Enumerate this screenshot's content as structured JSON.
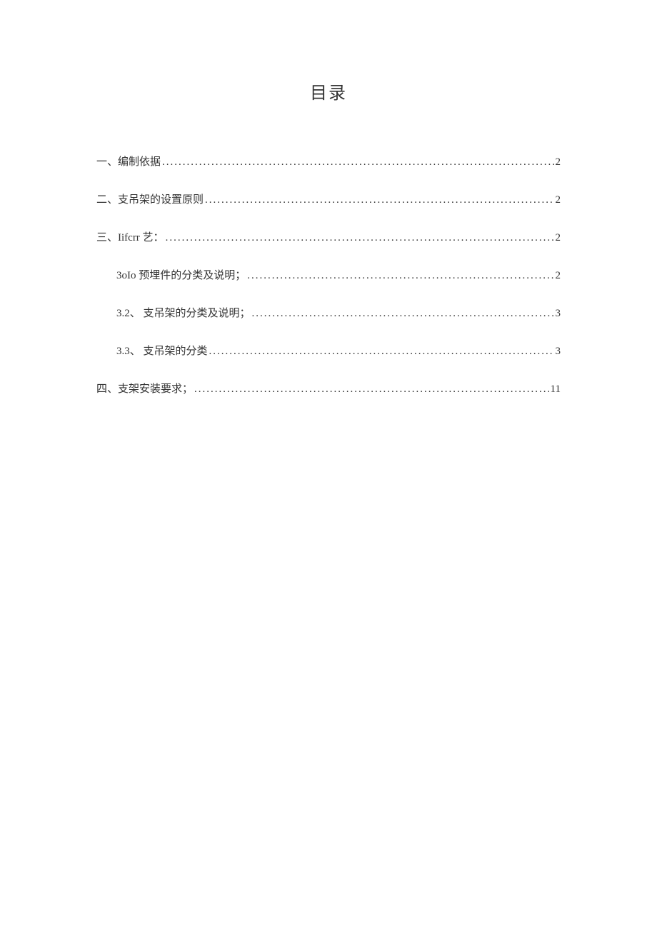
{
  "title": "目录",
  "entries": [
    {
      "label": "一、编制依据",
      "page": "2",
      "indent": false
    },
    {
      "label": "二、支吊架的设置原则",
      "page": "2",
      "indent": false
    },
    {
      "label": "三、Iifcrr 艺：",
      "page": "2",
      "indent": false
    },
    {
      "label": "3oIo 预埋件的分类及说明；",
      "page": "2",
      "indent": true
    },
    {
      "label": "3.2、 支吊架的分类及说明；",
      "page": "3",
      "indent": true
    },
    {
      "label": "3.3、 支吊架的分类",
      "page": "3",
      "indent": true
    },
    {
      "label": "四、支架安装要求；",
      "page": "11",
      "indent": false
    }
  ]
}
